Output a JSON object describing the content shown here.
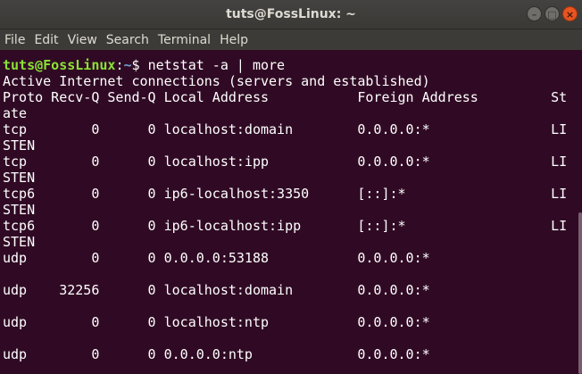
{
  "window": {
    "title": "tuts@FossLinux: ~",
    "buttons": {
      "minimize": "–",
      "maximize": "□",
      "close": "×"
    }
  },
  "menu": [
    "File",
    "Edit",
    "View",
    "Search",
    "Terminal",
    "Help"
  ],
  "terminal": {
    "prompt_user": "tuts@FossLinux",
    "prompt_sep": ":",
    "prompt_path": "~",
    "prompt_symbol": "$ ",
    "command": "netstat -a | more",
    "lines": [
      "Active Internet connections (servers and established)",
      "Proto Recv-Q Send-Q Local Address           Foreign Address         St",
      "ate",
      "tcp        0      0 localhost:domain        0.0.0.0:*               LI",
      "STEN",
      "tcp        0      0 localhost:ipp           0.0.0.0:*               LI",
      "STEN",
      "tcp6       0      0 ip6-localhost:3350      [::]:*                  LI",
      "STEN",
      "tcp6       0      0 ip6-localhost:ipp       [::]:*                  LI",
      "STEN",
      "udp        0      0 0.0.0.0:53188           0.0.0.0:*",
      "",
      "udp    32256      0 localhost:domain        0.0.0.0:*",
      "",
      "udp        0      0 localhost:ntp           0.0.0.0:*",
      "",
      "udp        0      0 0.0.0.0:ntp             0.0.0.0:*"
    ]
  },
  "colors": {
    "background": "#300a24",
    "prompt_user": "#8ae234",
    "prompt_path": "#729fcf",
    "text": "#ffffff"
  }
}
